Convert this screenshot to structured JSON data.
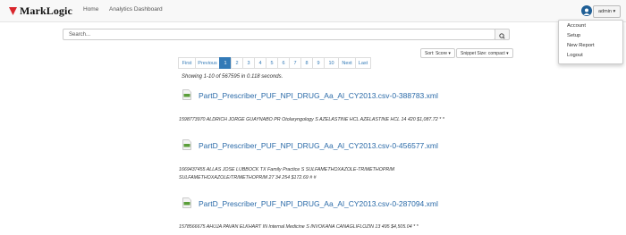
{
  "header": {
    "logo_text": "MarkLogic",
    "nav": [
      "Home",
      "Analytics Dashboard"
    ],
    "user_label": "admin ▾"
  },
  "user_menu": [
    "Account",
    "Setup",
    "New Report",
    "Logout"
  ],
  "search": {
    "placeholder": "Search...",
    "value": ""
  },
  "sort": {
    "sort_label": "Sort: Score ▾",
    "snippet_label": "Snippet Size: compact ▾"
  },
  "pagination": {
    "first": "First",
    "previous": "Previous",
    "pages": [
      "1",
      "2",
      "3",
      "4",
      "5",
      "6",
      "7",
      "8",
      "9",
      "10"
    ],
    "active": "1",
    "next": "Next",
    "last": "Last"
  },
  "showing": "Showing 1-10 of 567595 in 0.118 seconds.",
  "results": [
    {
      "title": "PartD_Prescriber_PUF_NPI_DRUG_Aa_Al_CY2013.csv-0-388783.xml",
      "snippet_lines": [
        "1598773970 ALDRICH JORGE GUAYNABO PR Otolaryngology S AZELASTINE HCL AZELASTINE HCL 14 420 $1,087.72 * *"
      ]
    },
    {
      "title": "PartD_Prescriber_PUF_NPI_DRUG_Aa_Al_CY2013.csv-0-456577.xml",
      "snippet_lines": [
        "1669437455 ALLAS JOSE LUBBOCK TX Family Practice S SULFAMETHOXAZOLE-TRIMETHOPRIM",
        "SULFAMETHOXAZOLE/TRIMETHOPRIM 27 34 254 $172.69 # #"
      ]
    },
    {
      "title": "PartD_Prescriber_PUF_NPI_DRUG_Aa_Al_CY2013.csv-0-287094.xml",
      "snippet_lines": [
        "1578566675 AHUJA PAVAN ELKHART IN Internal Medicine S INVOKANA CANAGLIFLOZIN 13 495 $4,505.04 * *"
      ]
    }
  ]
}
